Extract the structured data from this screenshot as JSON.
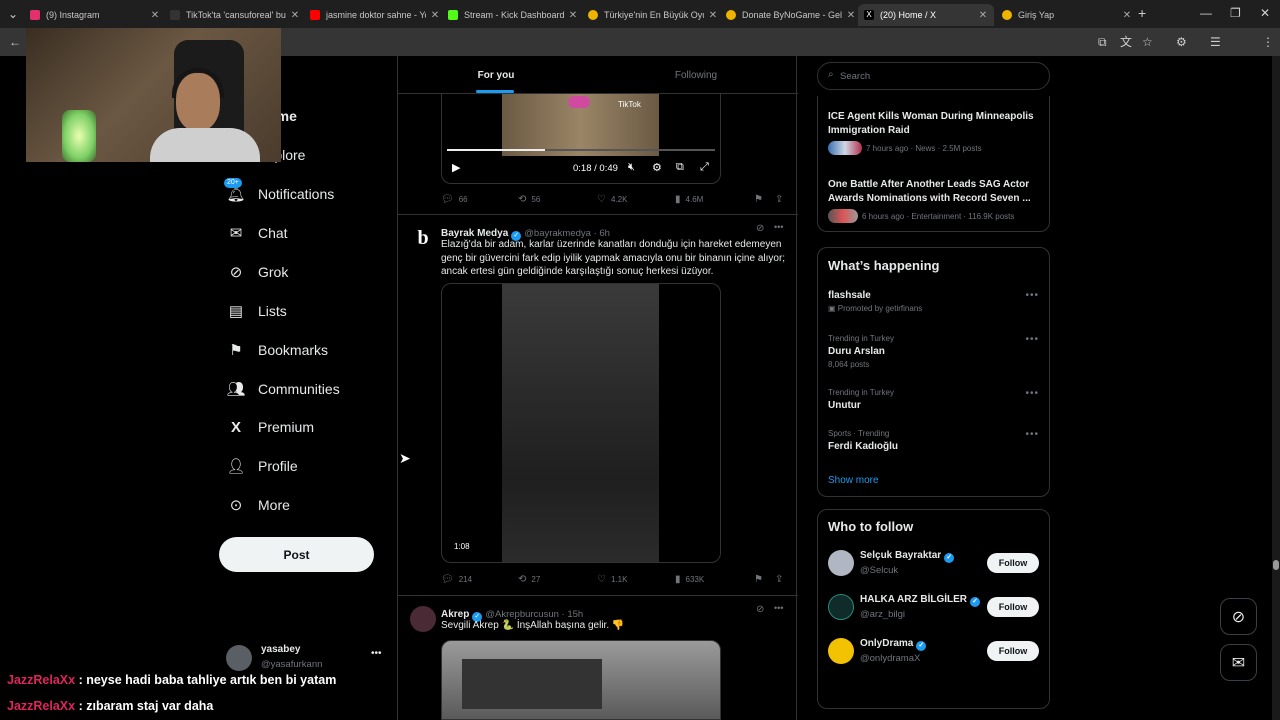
{
  "browser": {
    "tabs": [
      {
        "title": "(9) Instagram",
        "color": "#e1306c"
      },
      {
        "title": "TikTok'ta 'cansuforeal' bu",
        "color": "#111111"
      },
      {
        "title": "jasmine doktor sahne - Yo",
        "color": "#ff0000"
      },
      {
        "title": "Stream - Kick Dashboard",
        "color": "#53fc18"
      },
      {
        "title": "Türkiye'nin En Büyük Oyu",
        "color": "#f0b400"
      },
      {
        "title": "Donate ByNoGame - Geli",
        "color": "#f0b400"
      },
      {
        "title": "(20) Home / X",
        "color": "#000000"
      },
      {
        "title": "Giriş Yap",
        "color": "#f0b400"
      }
    ],
    "active_tab": 6
  },
  "nav": {
    "home": "Home",
    "explore": "Explore",
    "notifications": "Notifications",
    "notifications_badge": "20+",
    "chat": "Chat",
    "grok": "Grok",
    "lists": "Lists",
    "bookmarks": "Bookmarks",
    "communities": "Communities",
    "premium": "Premium",
    "profile": "Profile",
    "more": "More",
    "post": "Post",
    "account_name": "yasabey",
    "account_handle": "@yasafurkann"
  },
  "feed": {
    "tabs": [
      "For you",
      "Following"
    ],
    "video1": {
      "time": "0:18 / 0:49",
      "watermark": "TikTok"
    },
    "tweet0_stats": {
      "replies": "66",
      "reposts": "56",
      "likes": "4.2K",
      "views": "4.6M"
    },
    "tweet1": {
      "name": "Bayrak Medya",
      "handle": "@bayrakmedya",
      "time": "6h",
      "text": "Elazığ'da bir adam, karlar üzerinde kanatları donduğu için hareket edemeyen genç bir güvercini fark edip iyilik yapmak amacıyla onu bir binanın içine alıyor; ancak ertesi gün geldiğinde karşılaştığı sonuç herkesi üzüyor.",
      "video_duration": "1:08",
      "stats": {
        "replies": "214",
        "reposts": "27",
        "likes": "1.1K",
        "views": "633K"
      }
    },
    "tweet2": {
      "name": "Akrep",
      "handle": "@Akrepburcusun",
      "time": "15h",
      "text": "Sevgili Akrep 🐍 İnşAllah başına gelir. 👎"
    }
  },
  "sidebar": {
    "search_placeholder": "Search",
    "news": [
      {
        "title": "ICE Agent Kills Woman During Minneapolis Immigration Raid",
        "meta": "7 hours ago · News · 2.5M posts"
      },
      {
        "title": "One Battle After Another Leads SAG Actor Awards Nominations with Record Seven ...",
        "meta": "6 hours ago · Entertainment · 116.9K posts"
      }
    ],
    "happening_title": "What’s happening",
    "trends": [
      {
        "context": "",
        "name": "flashsale",
        "sub": "Promoted by getirfinans"
      },
      {
        "context": "Trending in Turkey",
        "name": "Duru Arslan",
        "sub": "8,064 posts"
      },
      {
        "context": "Trending in Turkey",
        "name": "Unutur",
        "sub": ""
      },
      {
        "context": "Sports · Trending",
        "name": "Ferdi Kadıoğlu",
        "sub": ""
      }
    ],
    "show_more": "Show more",
    "who_title": "Who to follow",
    "who": [
      {
        "name": "Selçuk Bayraktar",
        "handle": "@Selcuk",
        "button": "Follow"
      },
      {
        "name": "HALKA ARZ BİLGİLER",
        "handle": "@arz_bilgi",
        "button": "Follow"
      },
      {
        "name": "OnlyDrama",
        "handle": "@onlydramaX",
        "button": "Follow"
      }
    ]
  },
  "chat": [
    {
      "user": "JazzRelaXx",
      "message": "neyse hadi baba tahliye artık ben bi yatam"
    },
    {
      "user": "JazzRelaXx",
      "message": "zıbaram staj var daha"
    }
  ],
  "colors": {
    "accent": "#1d9bf0",
    "chat_user": "#e0245e"
  }
}
